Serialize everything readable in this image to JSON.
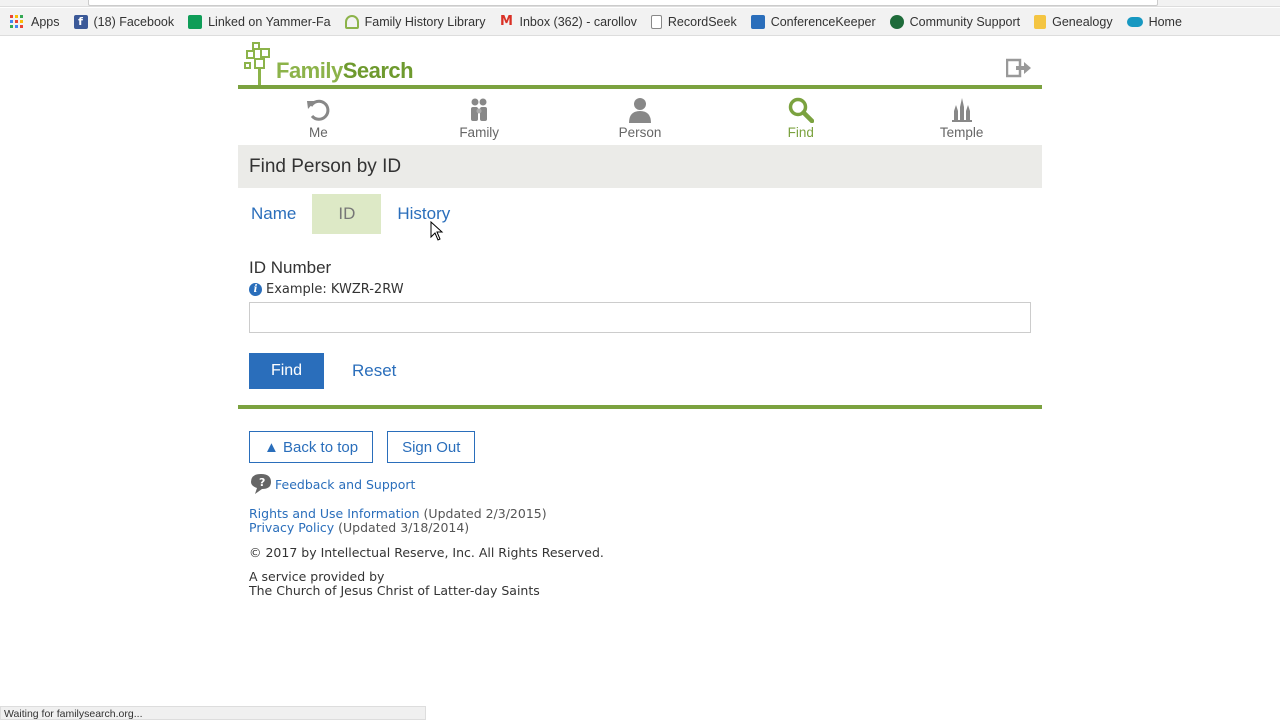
{
  "bookmarks": [
    {
      "label": "Apps",
      "icon": "apps-grid-icon"
    },
    {
      "label": "(18) Facebook",
      "icon": "facebook-icon",
      "color": "#3b5998"
    },
    {
      "label": "Linked on Yammer-Fa",
      "icon": "sheets-icon",
      "color": "#0f9d58"
    },
    {
      "label": "Family History Library",
      "icon": "tree-icon",
      "color": "#8cb34a"
    },
    {
      "label": "Inbox (362) - carollov",
      "icon": "gmail-icon",
      "color": "#d93025"
    },
    {
      "label": "RecordSeek",
      "icon": "page-icon",
      "color": "#888888"
    },
    {
      "label": "ConferenceKeeper",
      "icon": "calendar-icon",
      "color": "#2a6ebb"
    },
    {
      "label": "Community Support",
      "icon": "leaf-icon",
      "color": "#1e6b3a"
    },
    {
      "label": "Genealogy",
      "icon": "folder-icon",
      "color": "#f4c542"
    },
    {
      "label": "Home",
      "icon": "cloud-icon",
      "color": "#1798c1"
    }
  ],
  "header": {
    "logo_part1": "Family",
    "logo_part2": "Search"
  },
  "nav": [
    {
      "label": "Me",
      "icon": "undo-arrow-icon",
      "active": false
    },
    {
      "label": "Family",
      "icon": "family-icon",
      "active": false
    },
    {
      "label": "Person",
      "icon": "person-icon",
      "active": false
    },
    {
      "label": "Find",
      "icon": "magnifier-icon",
      "active": true
    },
    {
      "label": "Temple",
      "icon": "temple-icon",
      "active": false
    }
  ],
  "page_title": "Find Person by ID",
  "tabs": [
    {
      "label": "Name",
      "active": false
    },
    {
      "label": "ID",
      "active": true
    },
    {
      "label": "History",
      "active": false
    }
  ],
  "form": {
    "field_label": "ID Number",
    "hint": "Example: KWZR-2RW",
    "input_value": "",
    "find_label": "Find",
    "reset_label": "Reset"
  },
  "footer": {
    "back_to_top": "▲ Back to top",
    "sign_out": "Sign Out",
    "feedback": "Feedback and Support",
    "rights_link": "Rights and Use Information",
    "rights_updated": " (Updated 2/3/2015)",
    "privacy_link": "Privacy Policy",
    "privacy_updated": " (Updated 3/18/2014)",
    "copyright": "© 2017 by Intellectual Reserve, Inc. All Rights Reserved.",
    "service_line1": "A service provided by",
    "service_line2": "The Church of Jesus Christ of Latter-day Saints"
  },
  "status": "Waiting for familysearch.org...",
  "colors": {
    "brand_green": "#7ba23f",
    "link_blue": "#2a6ebb",
    "active_tab_bg": "#dde9c6",
    "title_bar_bg": "#ebebe8"
  }
}
